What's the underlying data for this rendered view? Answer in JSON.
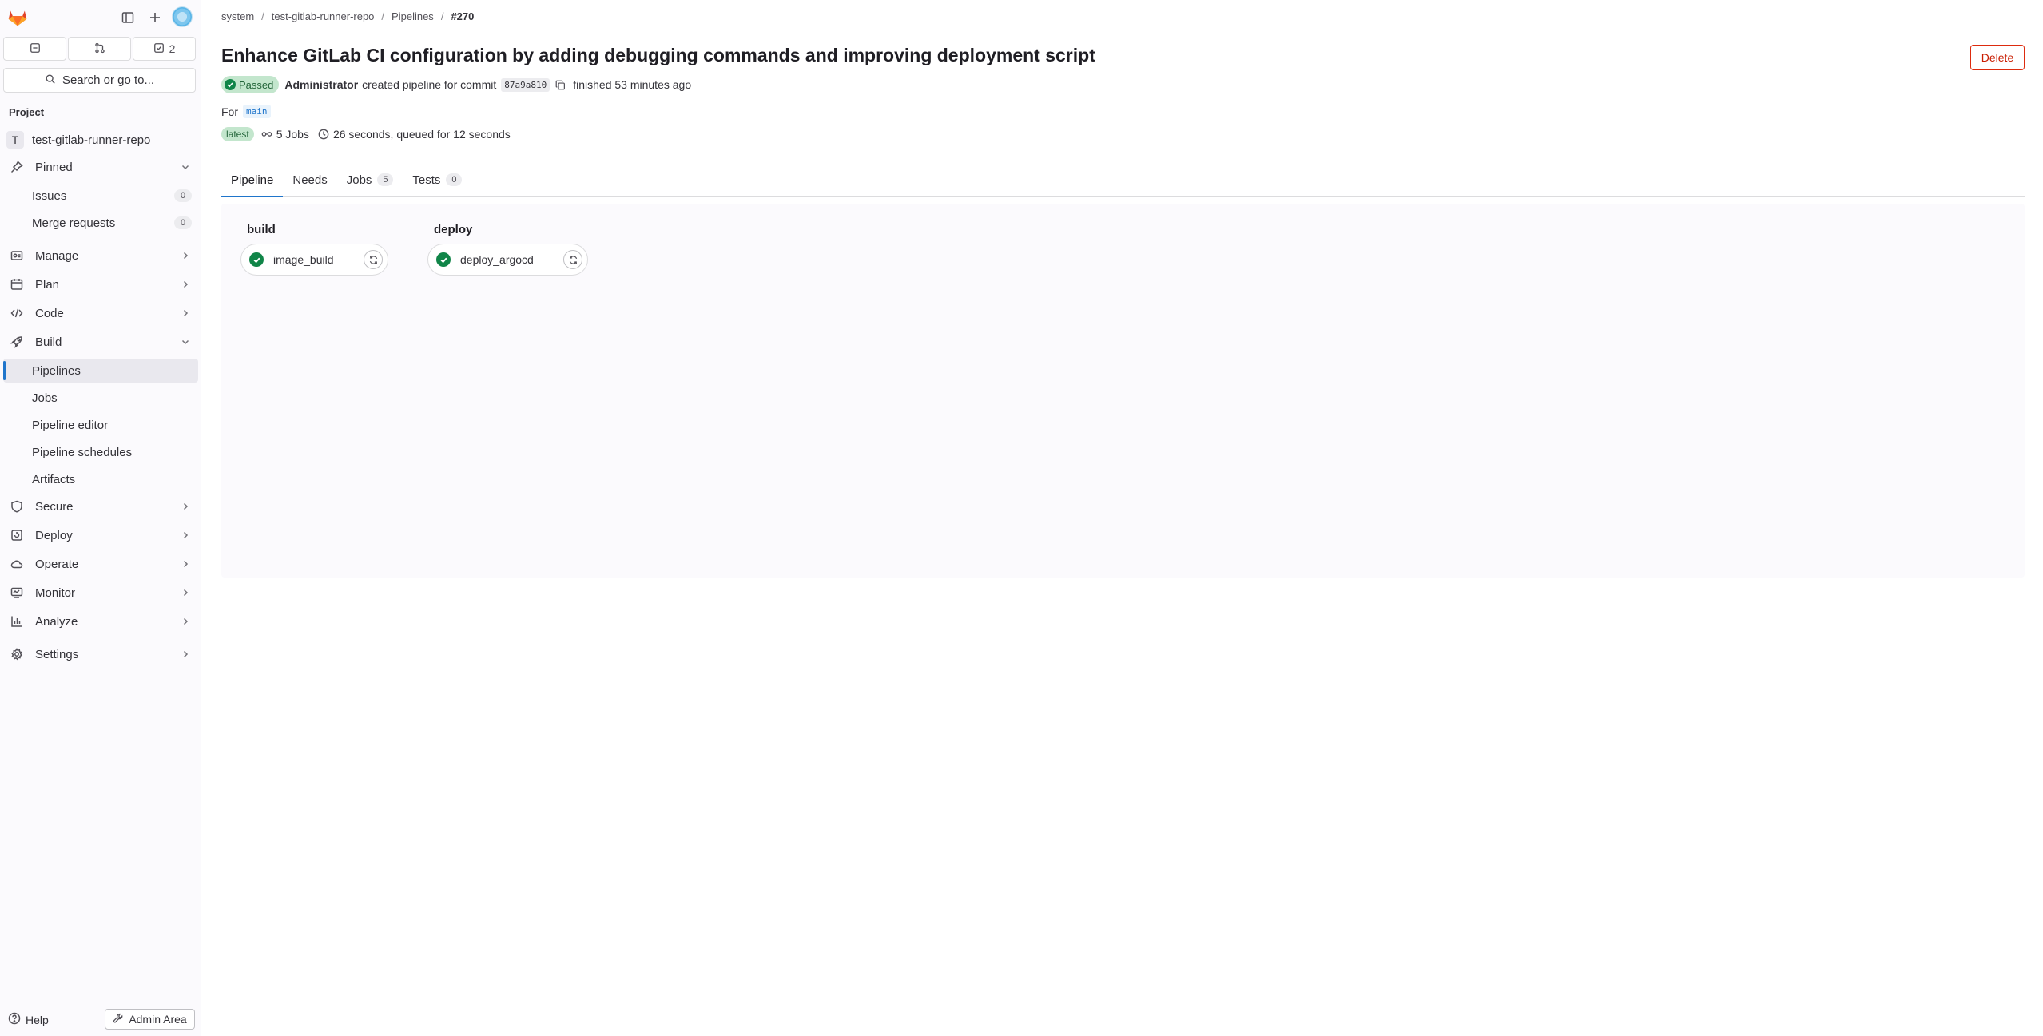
{
  "sidebar": {
    "counters": [
      {
        "icon": "issues-icon",
        "count": ""
      },
      {
        "icon": "merge-request-icon",
        "count": ""
      },
      {
        "icon": "todo-icon",
        "count": "2"
      }
    ],
    "search_label": "Search or go to...",
    "section_label": "Project",
    "project": {
      "avatar_letter": "T",
      "name": "test-gitlab-runner-repo"
    },
    "pinned": {
      "label": "Pinned",
      "items": [
        {
          "label": "Issues",
          "count": "0"
        },
        {
          "label": "Merge requests",
          "count": "0"
        }
      ]
    },
    "nav": [
      {
        "label": "Manage",
        "icon": "manage-icon"
      },
      {
        "label": "Plan",
        "icon": "plan-icon"
      },
      {
        "label": "Code",
        "icon": "code-icon"
      },
      {
        "label": "Build",
        "icon": "rocket-icon"
      }
    ],
    "build_items": [
      {
        "label": "Pipelines",
        "active": true
      },
      {
        "label": "Jobs"
      },
      {
        "label": "Pipeline editor"
      },
      {
        "label": "Pipeline schedules"
      },
      {
        "label": "Artifacts"
      }
    ],
    "nav_after": [
      {
        "label": "Secure",
        "icon": "shield-icon"
      },
      {
        "label": "Deploy",
        "icon": "deploy-icon"
      },
      {
        "label": "Operate",
        "icon": "cloud-icon"
      },
      {
        "label": "Monitor",
        "icon": "monitor-icon"
      },
      {
        "label": "Analyze",
        "icon": "chart-icon"
      }
    ],
    "settings_label": "Settings",
    "help_label": "Help",
    "admin_label": "Admin Area"
  },
  "breadcrumb": [
    "system",
    "test-gitlab-runner-repo",
    "Pipelines",
    "#270"
  ],
  "pipeline": {
    "title": "Enhance GitLab CI configuration by adding debugging commands and improving deployment script",
    "delete_label": "Delete",
    "status": "Passed",
    "author": "Administrator",
    "created_text": "created pipeline for commit",
    "commit_sha": "87a9a810",
    "finished_text": "finished 53 minutes ago",
    "for_label": "For",
    "branch": "main",
    "latest_label": "latest",
    "jobs_text": "5 Jobs",
    "duration_text": "26 seconds, queued for 12 seconds"
  },
  "tabs": [
    {
      "label": "Pipeline",
      "active": true
    },
    {
      "label": "Needs"
    },
    {
      "label": "Jobs",
      "count": "5"
    },
    {
      "label": "Tests",
      "count": "0"
    }
  ],
  "stages": [
    {
      "name": "build",
      "jobs": [
        {
          "name": "image_build",
          "status": "success"
        }
      ]
    },
    {
      "name": "deploy",
      "jobs": [
        {
          "name": "deploy_argocd",
          "status": "success"
        }
      ]
    }
  ],
  "colors": {
    "accent": "#1f75cb",
    "success": "#108548",
    "danger": "#dd2b0e"
  }
}
